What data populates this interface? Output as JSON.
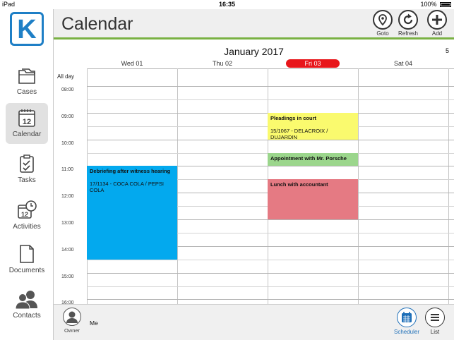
{
  "status_bar": {
    "device": "iPad",
    "time": "16:35",
    "battery": "100%"
  },
  "app": {
    "logo_letter": "K",
    "title": "Calendar"
  },
  "sidebar": {
    "items": [
      {
        "label": "Cases",
        "icon": "folder-icon"
      },
      {
        "label": "Calendar",
        "icon": "calendar-icon",
        "active": true
      },
      {
        "label": "Tasks",
        "icon": "clipboard-icon"
      },
      {
        "label": "Activities",
        "icon": "calendar-clock-icon"
      },
      {
        "label": "Documents",
        "icon": "document-icon"
      },
      {
        "label": "Contacts",
        "icon": "people-icon"
      }
    ]
  },
  "toolbar": {
    "goto": "Goto",
    "refresh": "Refresh",
    "add": "Add"
  },
  "calendar": {
    "month": "January 2017",
    "week_number": "5",
    "all_day_label": "All day",
    "days": [
      "Wed 01",
      "Thu 02",
      "Fri 03",
      "Sat 04"
    ],
    "today_index": 2,
    "times": [
      "08:00",
      "09:00",
      "10:00",
      "11:00",
      "12:00",
      "13:00",
      "14:00",
      "15:00",
      "16:00"
    ],
    "events": [
      {
        "title": "Debriefing after witness hearing",
        "detail": "17/1134 - COCA COLA / PEPSI COLA",
        "day": 0,
        "start": "11:00",
        "end": "14:30",
        "color": "#03a9ee"
      },
      {
        "title": "Pleadings in court",
        "detail": "15/1067 - DELACROIX / DUJARDIN",
        "day": 2,
        "start": "09:00",
        "end": "10:00",
        "color": "#fafa6e"
      },
      {
        "title": "Appointment with Mr. Porsche",
        "detail": "",
        "day": 2,
        "start": "10:30",
        "end": "11:00",
        "color": "#9bd68c"
      },
      {
        "title": "Lunch with accountant",
        "detail": "",
        "day": 2,
        "start": "11:30",
        "end": "13:00",
        "color": "#e57a83"
      }
    ]
  },
  "bottom_bar": {
    "owner_label": "Owner",
    "owner_value": "Me",
    "scheduler": "Scheduler",
    "list": "List"
  },
  "colors": {
    "accent_green": "#79b143",
    "brand_blue": "#1e7fc6",
    "today_red": "#e8161b"
  }
}
